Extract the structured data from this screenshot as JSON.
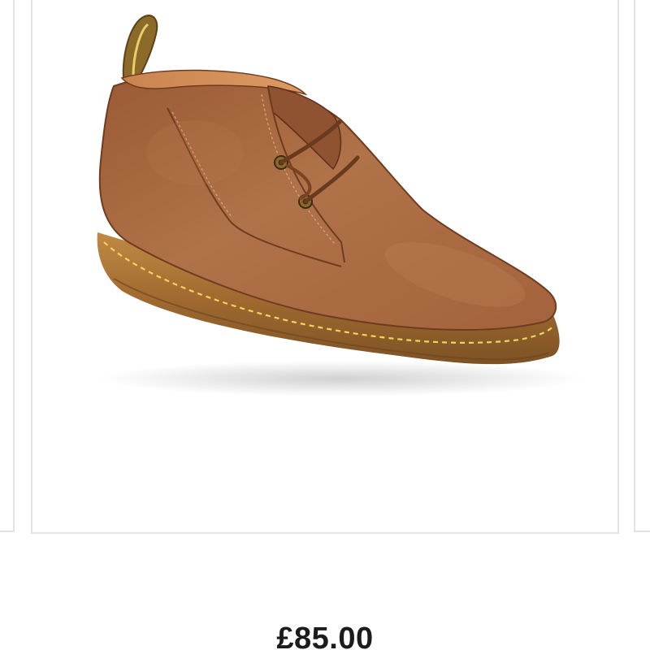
{
  "product": {
    "price": "£85.00",
    "image_subject": "brown-leather-chukka-boot-icon"
  },
  "colors": {
    "leather": "#A8683F",
    "leather_dark": "#7A4424",
    "sole": "#B07A3A",
    "stitch": "#F2D45C",
    "border": "#e3e3e3",
    "price_text": "#1c1c1c"
  }
}
